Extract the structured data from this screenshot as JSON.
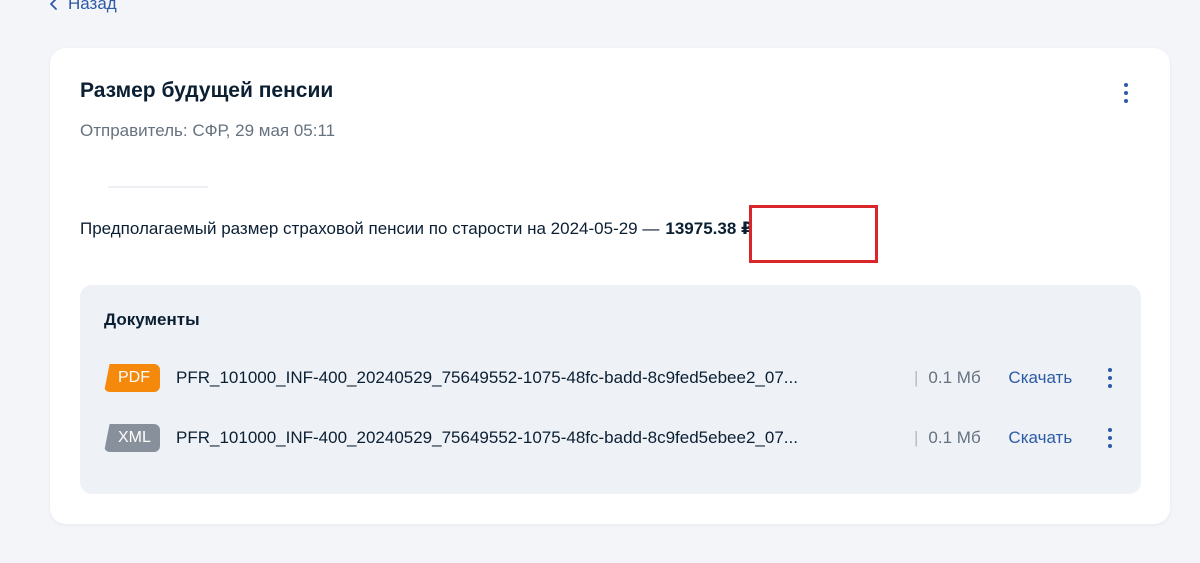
{
  "nav": {
    "back_label": "Назад"
  },
  "message": {
    "title": "Размер будущей пенсии",
    "sender": "Отправитель: СФР, 29 мая 05:11",
    "pension_text": "Предполагаемый размер страховой пенсии по старости на 2024-05-29 —",
    "pension_amount": "13975.38 ₽"
  },
  "documents": {
    "title": "Документы",
    "items": [
      {
        "type": "PDF",
        "badge_color": "#f4890b",
        "filename": "PFR_101000_INF-400_20240529_75649552-1075-48fc-badd-8c9fed5ebee2_07...",
        "separator": "|",
        "size": "0.1 Мб",
        "download_label": "Скачать"
      },
      {
        "type": "XML",
        "badge_color": "#88909b",
        "filename": "PFR_101000_INF-400_20240529_75649552-1075-48fc-badd-8c9fed5ebee2_07...",
        "separator": "|",
        "size": "0.1 Мб",
        "download_label": "Скачать"
      }
    ]
  },
  "colors": {
    "accent": "#2d5ba6",
    "highlight": "#d8262b",
    "background": "#f3f5f9"
  }
}
